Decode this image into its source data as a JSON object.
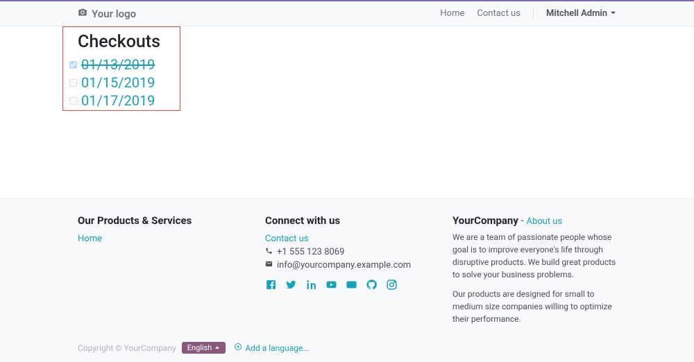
{
  "header": {
    "logo_text": "Your logo",
    "nav": {
      "home": "Home",
      "contact": "Contact us",
      "user": "Mitchell Admin"
    }
  },
  "main": {
    "title": "Checkouts",
    "items": [
      {
        "label": "01/13/2019",
        "checked": true
      },
      {
        "label": "01/15/2019",
        "checked": false
      },
      {
        "label": "01/17/2019",
        "checked": false
      }
    ]
  },
  "footer": {
    "col1": {
      "title": "Our Products & Services",
      "link": "Home"
    },
    "col2": {
      "title": "Connect with us",
      "contact_link": "Contact us",
      "phone": "+1 555 123 8069",
      "email": "info@yourcompany.example.com"
    },
    "col3": {
      "company": "YourCompany",
      "dash": " - ",
      "about": "About us",
      "p1": "We are a team of passionate people whose goal is to improve everyone's life through disruptive products. We build great products to solve your business problems.",
      "p2": "Our products are designed for small to medium size companies willing to optimize their performance."
    },
    "bottom": {
      "copyright": "Copyright © YourCompany",
      "language": "English",
      "add_language": "Add a language..."
    }
  }
}
